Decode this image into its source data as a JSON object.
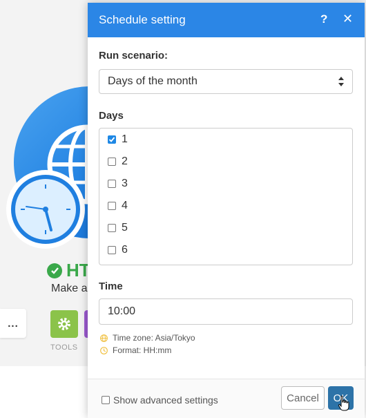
{
  "background": {
    "module_title": "HT",
    "module_description": "Make a",
    "more_button": "...",
    "tools_label": "TOOLS"
  },
  "dialog": {
    "title": "Schedule setting",
    "help_icon": "help-icon",
    "close_icon": "close-icon",
    "run_scenario_label": "Run scenario:",
    "run_scenario_value": "Days of the month",
    "days_label": "Days",
    "days": [
      {
        "label": "1",
        "checked": true
      },
      {
        "label": "2",
        "checked": false
      },
      {
        "label": "3",
        "checked": false
      },
      {
        "label": "4",
        "checked": false
      },
      {
        "label": "5",
        "checked": false
      },
      {
        "label": "6",
        "checked": false
      }
    ],
    "time_label": "Time",
    "time_value": "10:00",
    "timezone_hint": "Time zone: Asia/Tokyo",
    "format_hint": "Format: HH:mm",
    "advanced_label": "Show advanced settings",
    "advanced_checked": false,
    "cancel_label": "Cancel",
    "ok_label": "OK"
  },
  "colors": {
    "header": "#2b86e6",
    "ok_button": "#2d73a8",
    "checkbox_checked": "#1e88e5",
    "success": "#3aa84a",
    "tools": "#8bc34a",
    "hint_icon": "#f0c040"
  }
}
